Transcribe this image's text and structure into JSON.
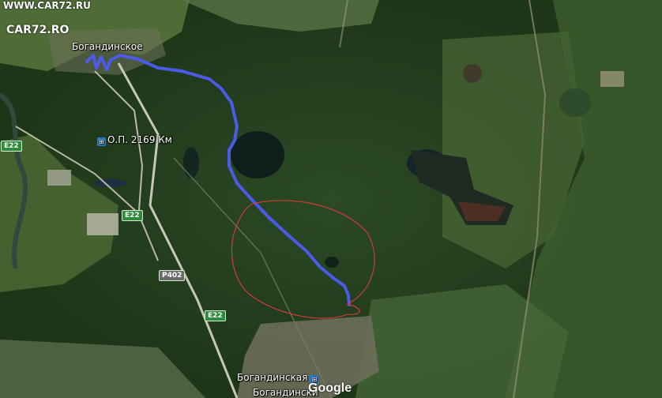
{
  "watermark": {
    "url": "WWW.CAR72.RU",
    "logo": "CAR72.RO"
  },
  "places": {
    "village_top": "Богандинское",
    "station_top": "О.П. 2169 Км",
    "station_bottom": "Богандинская",
    "village_bottom": "Богандински"
  },
  "roads": {
    "e22_a": "E22",
    "e22_b": "E22",
    "e22_c": "E22",
    "p402": "P402"
  },
  "attribution": "Google",
  "colors": {
    "route": "#4a5be8",
    "circle": "#d43a3a",
    "shield": "#2e8b3a",
    "rail_icon": "#2a7fd4"
  }
}
